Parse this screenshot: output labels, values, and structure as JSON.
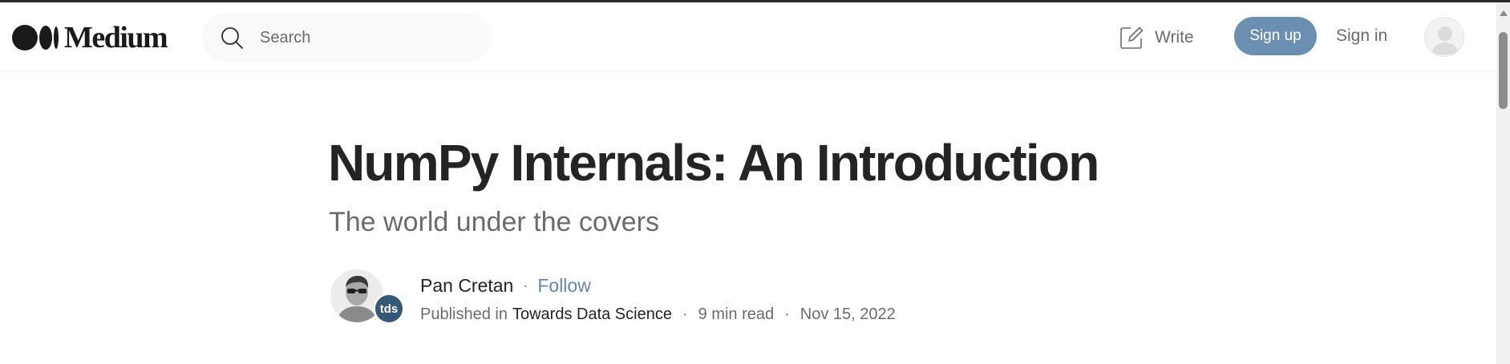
{
  "header": {
    "logo_text": "Medium",
    "search": {
      "placeholder": "Search"
    },
    "write_label": "Write",
    "signup_label": "Sign up",
    "signin_label": "Sign in"
  },
  "article": {
    "title": "NumPy Internals: An Introduction",
    "subtitle": "The world under the covers",
    "author": {
      "name": "Pan Cretan",
      "separator": "·",
      "follow_label": "Follow"
    },
    "publication": {
      "published_in_label": "Published in",
      "name": "Towards Data Science",
      "badge": "tds"
    },
    "read_time": "9 min read",
    "date": "Nov 15, 2022",
    "meta_separator": "·"
  },
  "colors": {
    "signup_bg": "#6b8fb1",
    "follow_link": "#5e87ad",
    "text_primary": "#242424",
    "text_secondary": "#6b6b6b",
    "badge_bg": "#355876"
  },
  "icons": {
    "logo": "medium-logo-icon",
    "search": "search-icon",
    "write": "write-icon",
    "user": "user-avatar-icon"
  }
}
